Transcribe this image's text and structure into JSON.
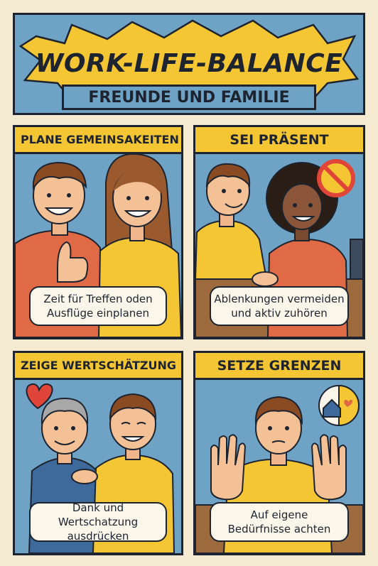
{
  "header": {
    "title": "WORK-LIFE-BALANCE",
    "subtitle": "FREUNDE UND FAMILIE"
  },
  "panels": [
    {
      "heading": "PLANE GEMEINSAKEITEN",
      "caption_line1": "Zeit für Treffen oden",
      "caption_line2": "Ausflüge einplanen"
    },
    {
      "heading": "SEI PRÄSENT",
      "caption_line1": "Ablenkungen vermeiden",
      "caption_line2": "und aktiv zuhören"
    },
    {
      "heading": "ZEIGE WERTSCHÄTZUNG",
      "caption_line1": "Dank und",
      "caption_line2": "Wertschatzung ausdrücken"
    },
    {
      "heading": "SETZE GRENZEN",
      "caption_line1": "Auf eigene",
      "caption_line2": "Bedürfnisse achten"
    }
  ],
  "colors": {
    "background": "#f5ead2",
    "sky_blue": "#6fa3c6",
    "yellow": "#f5c633",
    "red_shirt": "#e06a45",
    "outline": "#1d2430"
  }
}
